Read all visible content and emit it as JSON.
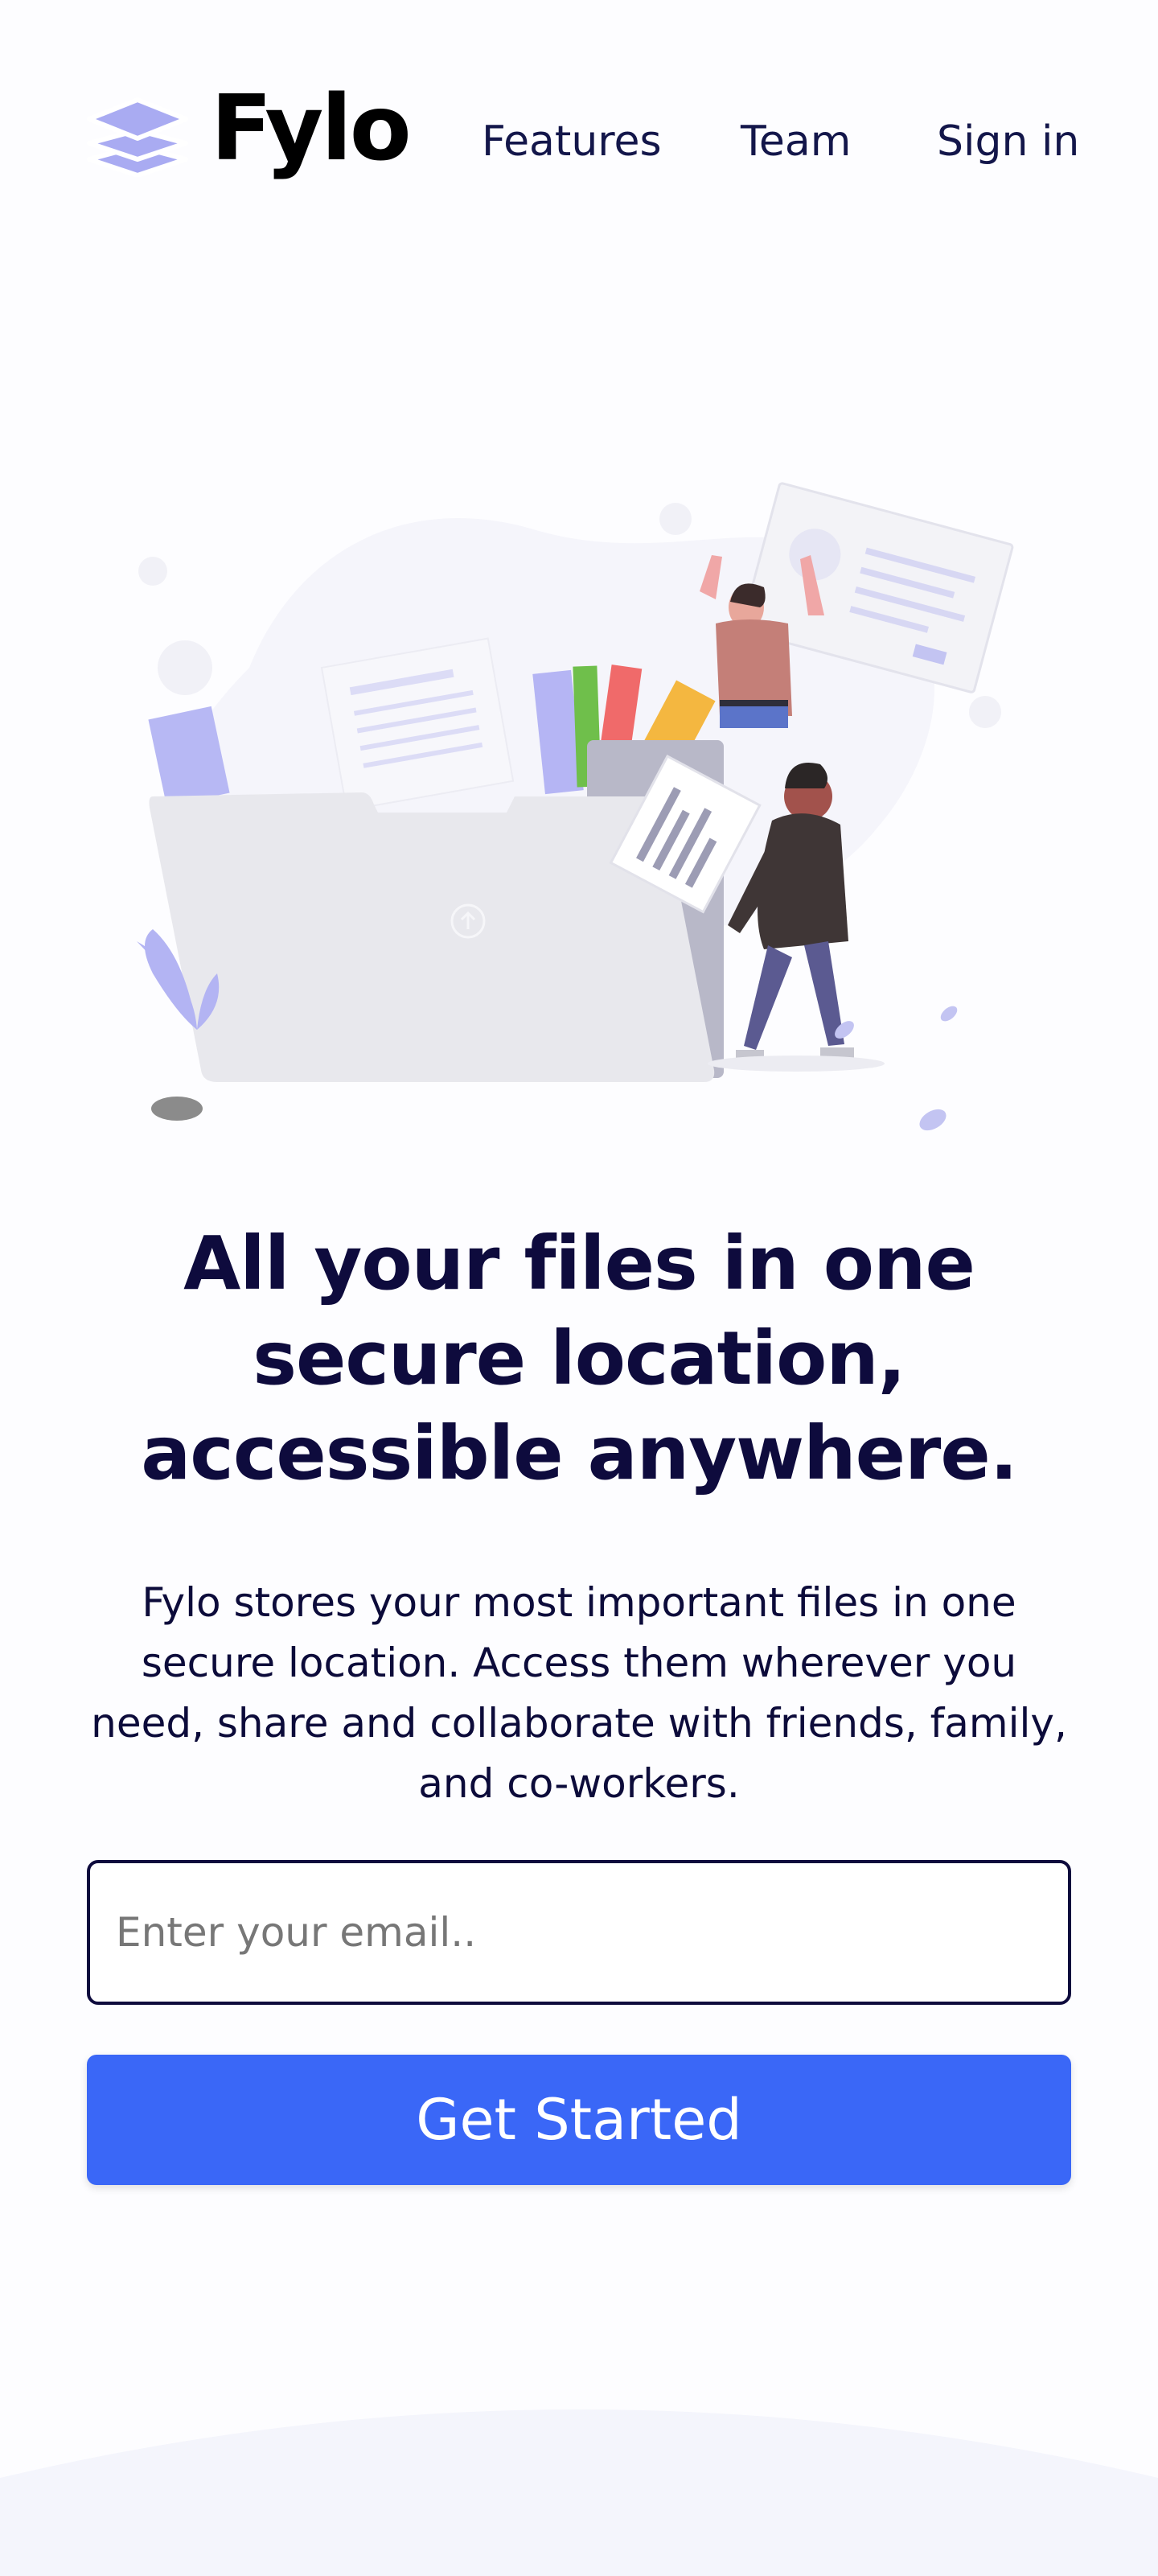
{
  "brand": {
    "name": "Fylo",
    "logo_icon": "stacked-layers-icon",
    "accent_color": "#3a67f7",
    "logo_color": "#a9abf2"
  },
  "nav": {
    "items": [
      {
        "label": "Features"
      },
      {
        "label": "Team"
      },
      {
        "label": "Sign in"
      }
    ]
  },
  "hero": {
    "illustration": "files-folder-illustration",
    "headline_lines": [
      "All your files in one",
      "secure location,",
      "accessible anywhere."
    ],
    "subtext_lines": [
      "Fylo stores your most important files in one",
      "secure location. Access them wherever you",
      "need, share and collaborate with friends, family,",
      "and co-workers."
    ]
  },
  "form": {
    "email_placeholder": "Enter your email..",
    "email_value": "",
    "submit_label": "Get Started"
  }
}
